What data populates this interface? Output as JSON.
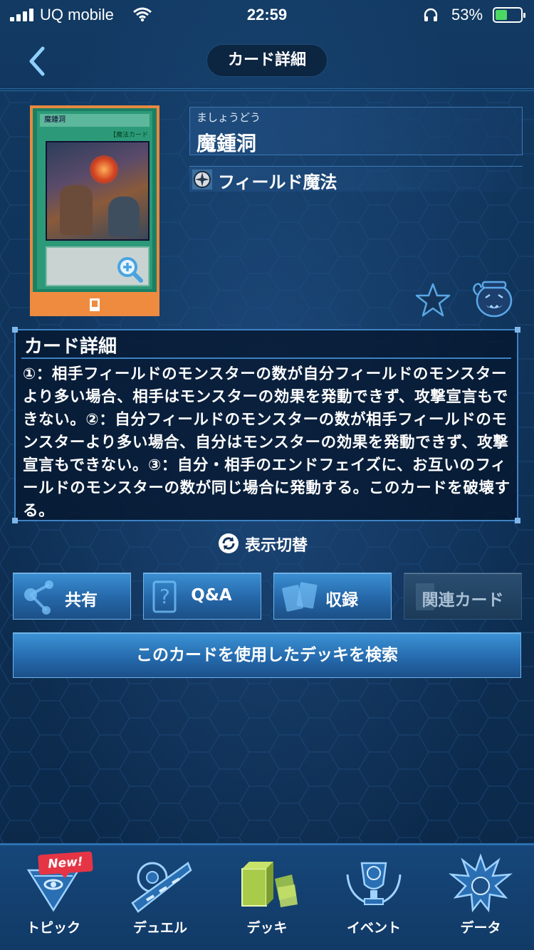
{
  "status_bar": {
    "carrier": "UQ mobile",
    "time": "22:59",
    "battery_percent": "53%",
    "battery_level": 0.53
  },
  "header": {
    "title": "カード詳細",
    "back_icon": "chevron-left-icon"
  },
  "card": {
    "ruby": "ましょうどう",
    "name": "魔鍾洞",
    "attribute": "フィールド魔法",
    "image_title": "魔鍾洞",
    "image_type_line": "【魔法カード",
    "frame_color": "#e8893f"
  },
  "detail": {
    "heading": "カード詳細",
    "text": "①：相手フィールドのモンスターの数が自分フィールドのモンスターより多い場合、相手はモンスターの効果を発動できず、攻撃宣言もできない。②：自分フィールドのモンスターの数が相手フィールドのモンスターより多い場合、自分はモンスターの効果を発動できず、攻撃宣言もできない。③：自分・相手のエンドフェイズに、お互いのフィールドのモンスターの数が同じ場合に発動する。このカードを破壊する。"
  },
  "toggle": {
    "label": "表示切替"
  },
  "actions": [
    {
      "label": "共有",
      "icon": "share-icon"
    },
    {
      "label": "Q&A",
      "icon": "qa-icon"
    },
    {
      "label": "収録",
      "icon": "cards-icon"
    },
    {
      "label": "関連カード",
      "icon": "related-cards-icon"
    }
  ],
  "search_button": "このカードを使用したデッキを検索",
  "tabbar": {
    "new_badge": "New!",
    "items": [
      {
        "label": "トピック",
        "icon": "millennium-pyramid-icon"
      },
      {
        "label": "デュエル",
        "icon": "duel-disk-icon"
      },
      {
        "label": "デッキ",
        "icon": "deck-icon"
      },
      {
        "label": "イベント",
        "icon": "trophy-icon"
      },
      {
        "label": "データ",
        "icon": "character-icon"
      }
    ]
  },
  "colors": {
    "accent": "#3d82c4",
    "button": "#2567a8",
    "card_frame": "#e8893f",
    "badge": "#e53545"
  }
}
